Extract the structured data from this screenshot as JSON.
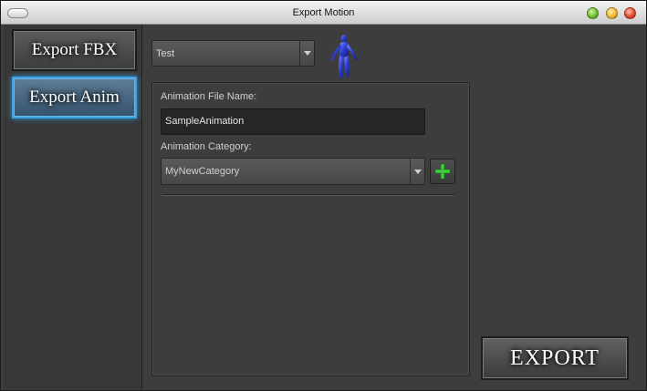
{
  "window": {
    "title": "Export Motion"
  },
  "sidebar": {
    "items": [
      {
        "label": "Export FBX",
        "selected": false
      },
      {
        "label": "Export Anim",
        "selected": true
      }
    ]
  },
  "profile_select": {
    "value": "Test"
  },
  "form": {
    "file_name_label": "Animation File Name:",
    "file_name_value": "SampleAnimation",
    "category_label": "Animation Category:",
    "category_value": "MyNewCategory"
  },
  "actions": {
    "export_label": "EXPORT"
  },
  "icons": {
    "character": "character-figure-icon",
    "add": "plus-icon",
    "dropdown": "chevron-down-icon"
  },
  "colors": {
    "accent_selected": "#3aa3e6",
    "add_green": "#3fcf3f",
    "figure_blue": "#2a3bd0"
  }
}
